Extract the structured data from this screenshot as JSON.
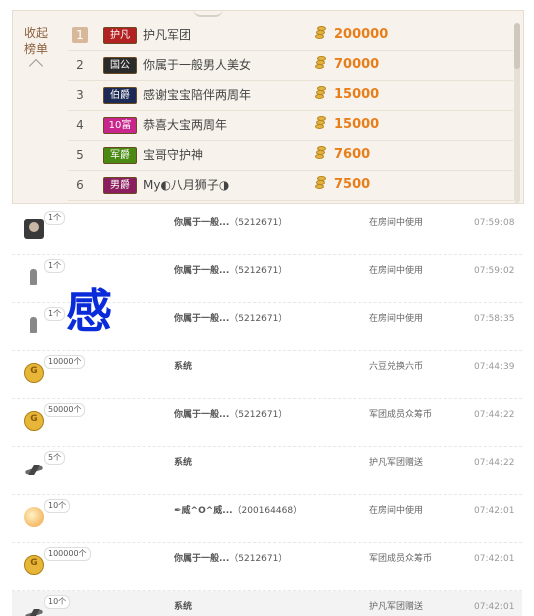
{
  "ranking": {
    "collapse_label": "收起榜单",
    "rows": [
      {
        "rank": "1",
        "badge": "护凡",
        "badge_color": "#b22222",
        "name": "护凡军团",
        "amount": "200000"
      },
      {
        "rank": "2",
        "badge": "国公",
        "badge_color": "#2b2b2b",
        "name": "你属于一般男人美女",
        "amount": "70000"
      },
      {
        "rank": "3",
        "badge": "伯爵",
        "badge_color": "#1d2a55",
        "name": "感谢宝宝陪伴两周年",
        "amount": "15000"
      },
      {
        "rank": "4",
        "badge": "10富",
        "badge_color": "#c8268c",
        "name": "恭喜大宝两周年",
        "amount": "15000"
      },
      {
        "rank": "5",
        "badge": "军爵",
        "badge_color": "#4a8a12",
        "name": "宝哥守护神",
        "amount": "7600"
      },
      {
        "rank": "6",
        "badge": "男爵",
        "badge_color": "#8a1e5e",
        "name": "My◐八月狮子◑",
        "amount": "7500"
      }
    ]
  },
  "overlay_char": "感",
  "log": [
    {
      "icon": "avatar-gift-icon",
      "count": "1个",
      "sender_name": "你属于一般...",
      "sender_id": "（5212671）",
      "action": "在房间中使用",
      "time": "07:59:08"
    },
    {
      "icon": "figure-gift-icon",
      "count": "1个",
      "sender_name": "你属于一般...",
      "sender_id": "（5212671）",
      "action": "在房间中使用",
      "time": "07:59:02"
    },
    {
      "icon": "figure-gift-icon",
      "count": "1个",
      "sender_name": "你属于一般...",
      "sender_id": "（5212671）",
      "action": "在房间中使用",
      "time": "07:58:35"
    },
    {
      "icon": "coin-gift-icon",
      "count": "10000个",
      "sender_name": "系统",
      "sender_id": "",
      "action": "六豆兑换六币",
      "time": "07:44:39"
    },
    {
      "icon": "coin-gift-icon",
      "count": "50000个",
      "sender_name": "你属于一般...",
      "sender_id": "（5212671）",
      "action": "军团成员众筹币",
      "time": "07:44:22"
    },
    {
      "icon": "plane-gift-icon",
      "count": "5个",
      "sender_name": "系统",
      "sender_id": "",
      "action": "护凡军团赠送",
      "time": "07:44:22"
    },
    {
      "icon": "orb-gift-icon",
      "count": "10个",
      "sender_name": "✒威^O^威...",
      "sender_id": "（200164468）",
      "action": "在房间中使用",
      "time": "07:42:01"
    },
    {
      "icon": "coin-gift-icon",
      "count": "100000个",
      "sender_name": "你属于一般...",
      "sender_id": "（5212671）",
      "action": "军团成员众筹币",
      "time": "07:42:01"
    },
    {
      "icon": "plane-gift-icon",
      "count": "10个",
      "sender_name": "系统",
      "sender_id": "",
      "action": "护凡军团赠送",
      "time": "07:42:01"
    }
  ]
}
